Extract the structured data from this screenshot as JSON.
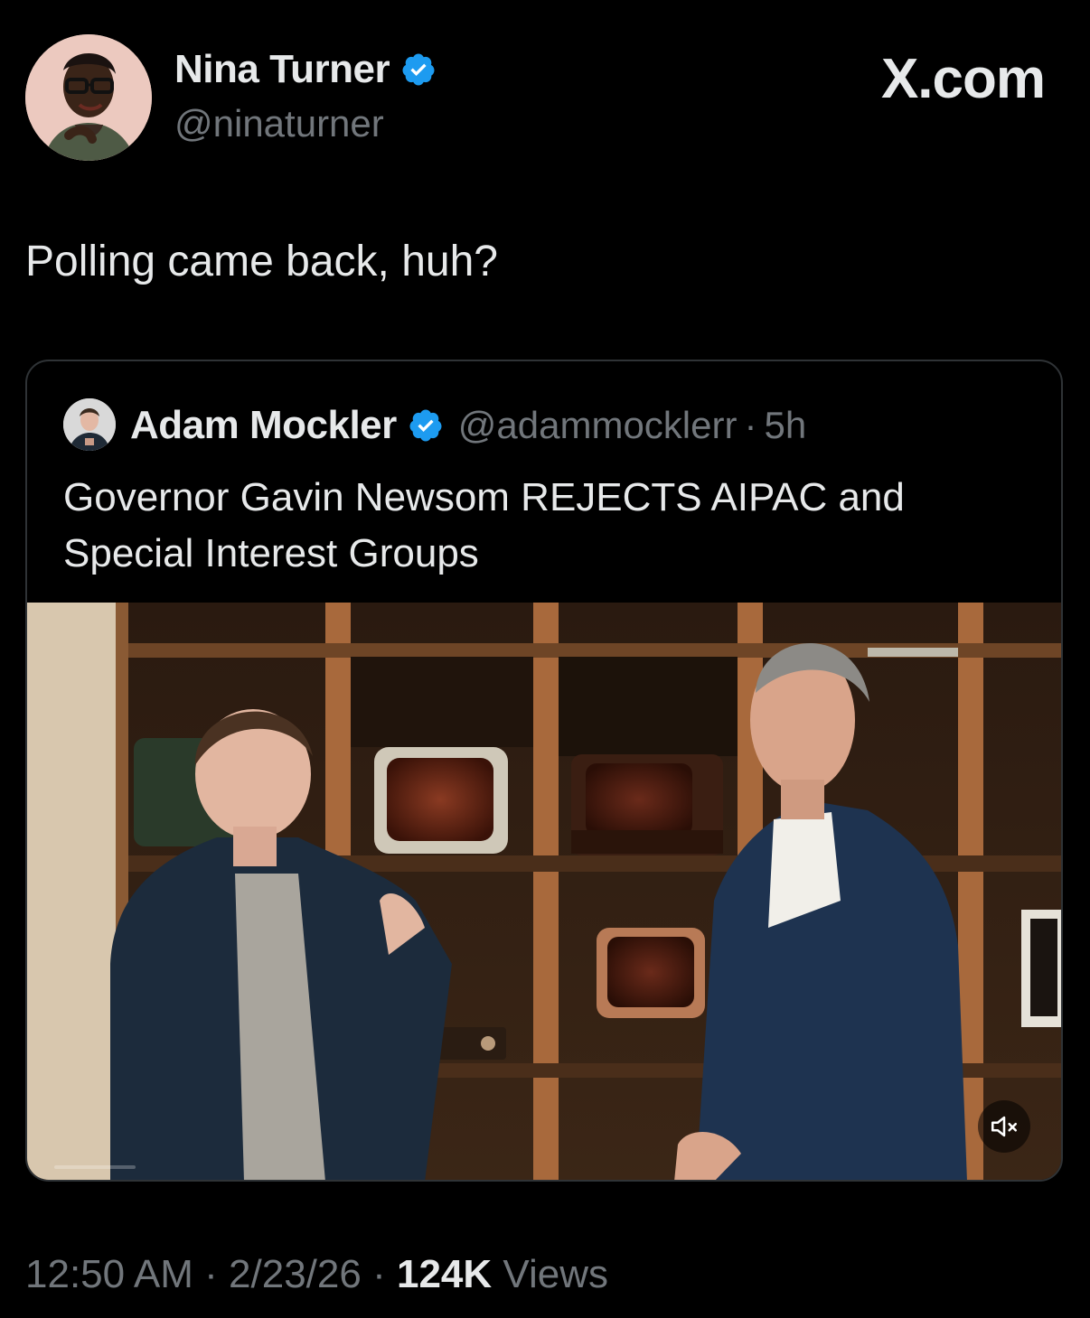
{
  "brand": "X.com",
  "tweet": {
    "author_name": "Nina Turner",
    "author_handle": "@ninaturner",
    "text": "Polling came back, huh?",
    "time": "12:50 AM",
    "date": "2/23/26",
    "separator": "·",
    "views_count": "124K",
    "views_label": "Views"
  },
  "quote": {
    "author_name": "Adam Mockler",
    "author_handle": "@adammocklerr",
    "separator": "·",
    "time": "5h",
    "text": "Governor Gavin Newsom REJECTS AIPAC and Special Interest Groups"
  },
  "colors": {
    "background": "#000000",
    "text_primary": "#e7e9ea",
    "text_secondary": "#71767b",
    "verified_blue": "#1d9bf0",
    "card_border": "#2f3336"
  },
  "icons": {
    "verified": "verified-badge-icon",
    "mute": "volume-muted-icon"
  }
}
